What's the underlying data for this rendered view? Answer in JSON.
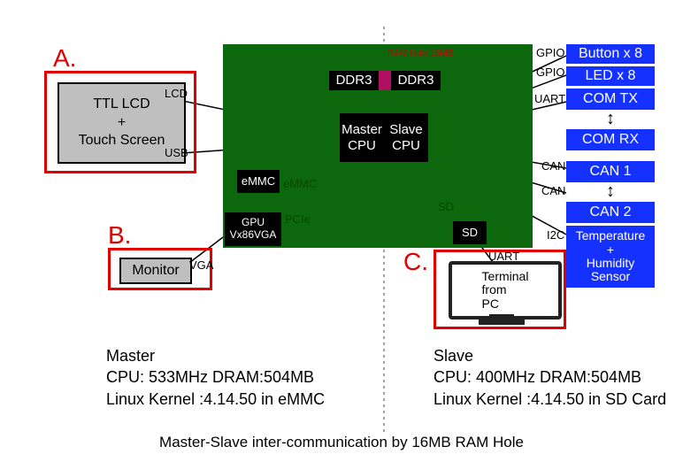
{
  "labels": {
    "A": "A.",
    "B": "B.",
    "C": "C."
  },
  "left": {
    "lcd_block": "TTL LCD\n+\nTouch Screen",
    "lcd_port": "LCD",
    "usb_port": "USB",
    "monitor": "Monitor",
    "vga_port": "VGA"
  },
  "board": {
    "ddr3_left": "DDR3",
    "ddr3_right": "DDR3",
    "ram_hole_note": "RAM Hole 16MB",
    "master_cpu": "Master\nCPU",
    "slave_cpu": "Slave\nCPU",
    "emmc_block": "eMMC",
    "emmc_port": "eMMC",
    "gpu_block": "GPU\nVx86VGA",
    "pcie_port": "PCIe",
    "sd_block": "SD",
    "sd_port": "SD"
  },
  "right": {
    "gpio1": "GPIO",
    "gpio2": "GPIO",
    "uart1": "UART",
    "can1": "CAN",
    "can2": "CAN",
    "i2c": "I2C",
    "buttons": "Button x 8",
    "leds": "LED x 8",
    "com_tx": "COM TX",
    "com_rx": "COM RX",
    "canA": "CAN 1",
    "canB": "CAN 2",
    "sensor": "Temperature\n+\nHumidity\nSensor"
  },
  "terminal": {
    "uart": "UART",
    "text": "Terminal\nfrom\nPC"
  },
  "captions": {
    "master": "Master\nCPU: 533MHz   DRAM:504MB\nLinux Kernel :4.14.50 in eMMC",
    "slave": "Slave\nCPU: 400MHz   DRAM:504MB\nLinux Kernel :4.14.50 in SD Card",
    "footer": "Master-Slave inter-communication by 16MB RAM Hole"
  },
  "chart_data": {
    "type": "table",
    "title": "Master-Slave inter-communication by 16MB RAM Hole",
    "nodes": [
      {
        "id": "ttl_lcd",
        "label": "TTL LCD + Touch Screen",
        "group": "A"
      },
      {
        "id": "monitor",
        "label": "Monitor",
        "group": "B"
      },
      {
        "id": "terminal",
        "label": "Terminal from PC",
        "group": "C"
      },
      {
        "id": "ddr3_l",
        "label": "DDR3"
      },
      {
        "id": "ddr3_r",
        "label": "DDR3"
      },
      {
        "id": "master_cpu",
        "label": "Master CPU"
      },
      {
        "id": "slave_cpu",
        "label": "Slave CPU"
      },
      {
        "id": "emmc",
        "label": "eMMC"
      },
      {
        "id": "gpu",
        "label": "GPU Vx86VGA"
      },
      {
        "id": "sd",
        "label": "SD"
      },
      {
        "id": "buttons",
        "label": "Button x 8"
      },
      {
        "id": "leds",
        "label": "LED x 8"
      },
      {
        "id": "com_tx",
        "label": "COM TX"
      },
      {
        "id": "com_rx",
        "label": "COM RX"
      },
      {
        "id": "can1",
        "label": "CAN 1"
      },
      {
        "id": "can2",
        "label": "CAN 2"
      },
      {
        "id": "sensor",
        "label": "Temperature + Humidity Sensor"
      }
    ],
    "edges": [
      {
        "from": "ttl_lcd",
        "to": "master_cpu",
        "label": "LCD"
      },
      {
        "from": "ttl_lcd",
        "to": "master_cpu",
        "label": "USB"
      },
      {
        "from": "monitor",
        "to": "gpu",
        "label": "VGA"
      },
      {
        "from": "gpu",
        "to": "master_cpu",
        "label": "PCIe"
      },
      {
        "from": "emmc",
        "to": "master_cpu",
        "label": "eMMC"
      },
      {
        "from": "ddr3_l",
        "to": "master_cpu",
        "label": ""
      },
      {
        "from": "ddr3_r",
        "to": "slave_cpu",
        "label": ""
      },
      {
        "from": "sd",
        "to": "slave_cpu",
        "label": "SD"
      },
      {
        "from": "terminal",
        "to": "slave_cpu",
        "label": "UART"
      },
      {
        "from": "buttons",
        "to": "slave_cpu",
        "label": "GPIO"
      },
      {
        "from": "leds",
        "to": "slave_cpu",
        "label": "GPIO"
      },
      {
        "from": "com_tx",
        "to": "slave_cpu",
        "label": "UART"
      },
      {
        "from": "com_rx",
        "to": "com_tx",
        "label": ""
      },
      {
        "from": "can1",
        "to": "slave_cpu",
        "label": "CAN"
      },
      {
        "from": "can2",
        "to": "slave_cpu",
        "label": "CAN"
      },
      {
        "from": "can1",
        "to": "can2",
        "label": ""
      },
      {
        "from": "sensor",
        "to": "slave_cpu",
        "label": "I2C"
      }
    ],
    "specs": {
      "master": {
        "cpu_mhz": 533,
        "dram_mb": 504,
        "kernel": "4.14.50",
        "storage": "eMMC"
      },
      "slave": {
        "cpu_mhz": 400,
        "dram_mb": 504,
        "kernel": "4.14.50",
        "storage": "SD Card"
      },
      "ram_hole_mb": 16
    }
  }
}
